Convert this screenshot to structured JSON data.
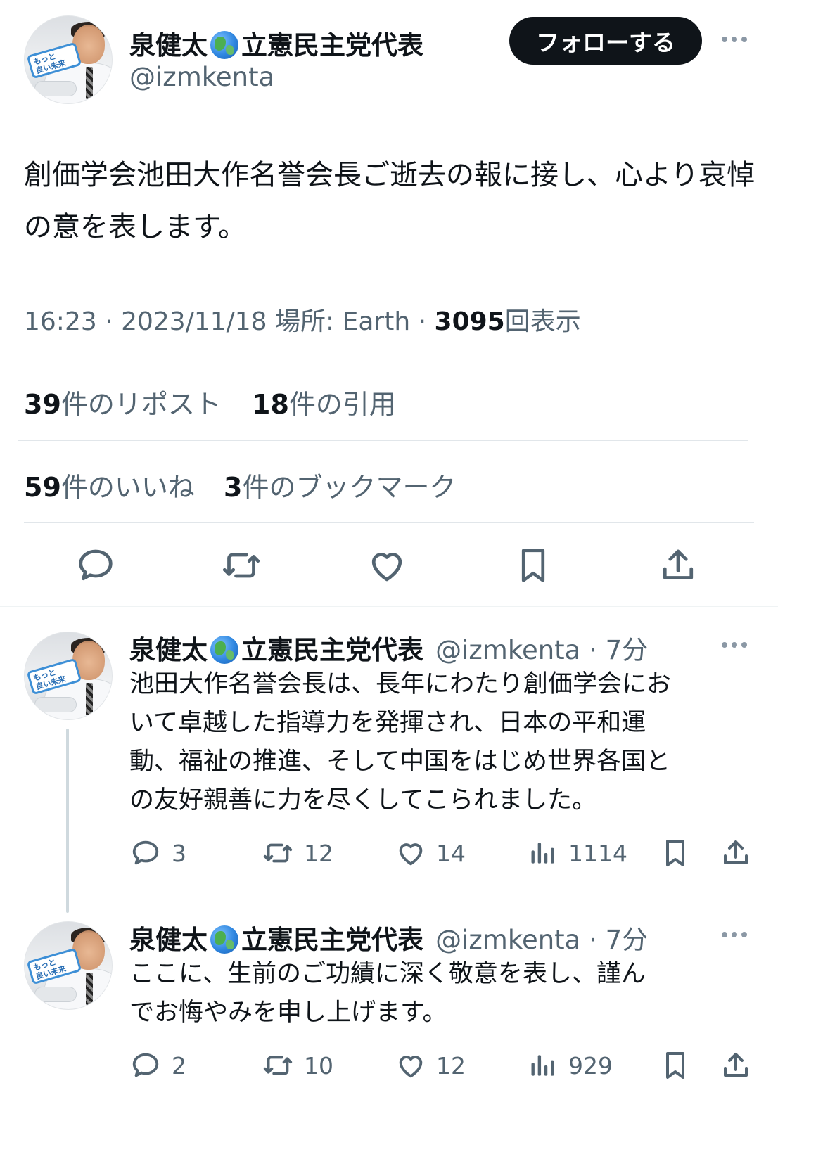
{
  "main_tweet": {
    "display_name_before": "泉健太",
    "display_name_after": "立憲民主党代表",
    "handle": "@izmkenta",
    "avatar_badge": "もっと\n良い未来へ!",
    "follow_label": "フォローする",
    "text": "創価学会池田大作名誉会長ご逝去の報に接し、心より哀悼の意を表します。",
    "time": "16:23 · 2023/11/18",
    "location_label": "場所: Earth",
    "separator": "·",
    "views_count": "3095",
    "views_label": "回表示",
    "reposts_count": "39",
    "reposts_label": "件のリポスト",
    "quotes_count": "18",
    "quotes_label": "件の引用",
    "likes_count": "59",
    "likes_label": "件のいいね",
    "bookmarks_count": "3",
    "bookmarks_label": "件のブックマーク"
  },
  "replies": [
    {
      "display_name_before": "泉健太",
      "display_name_after": "立憲民主党代表",
      "handle_time": "@izmkenta · 7分",
      "line1": "池田大作名誉会長は、長年にわたり創価学会にお",
      "line2": "いて卓越した指導力を発揮され、日本の平和運",
      "line3": "動、福祉の推進、そして中国をはじめ世界各国と",
      "line4": "の友好親善に力を尽くしてこられました。",
      "replies": "3",
      "reposts": "12",
      "likes": "14",
      "views": "1114"
    },
    {
      "display_name_before": "泉健太",
      "display_name_after": "立憲民主党代表",
      "handle_time": "@izmkenta · 7分",
      "line1": "ここに、生前のご功績に深く敬意を表し、謹ん",
      "line2": "でお悔やみを申し上げます。",
      "replies": "2",
      "reposts": "10",
      "likes": "12",
      "views": "929"
    }
  ],
  "colors": {
    "text": "#0f1419",
    "secondary": "#536471",
    "divider": "#e1e6ea",
    "button_bg": "#0f1419",
    "button_text": "#ffffff"
  },
  "icons": {
    "reply": "reply-icon",
    "repost": "repost-icon",
    "like": "heart-icon",
    "bookmark": "bookmark-icon",
    "share": "share-icon",
    "views": "views-chart-icon",
    "more": "more-icon"
  }
}
